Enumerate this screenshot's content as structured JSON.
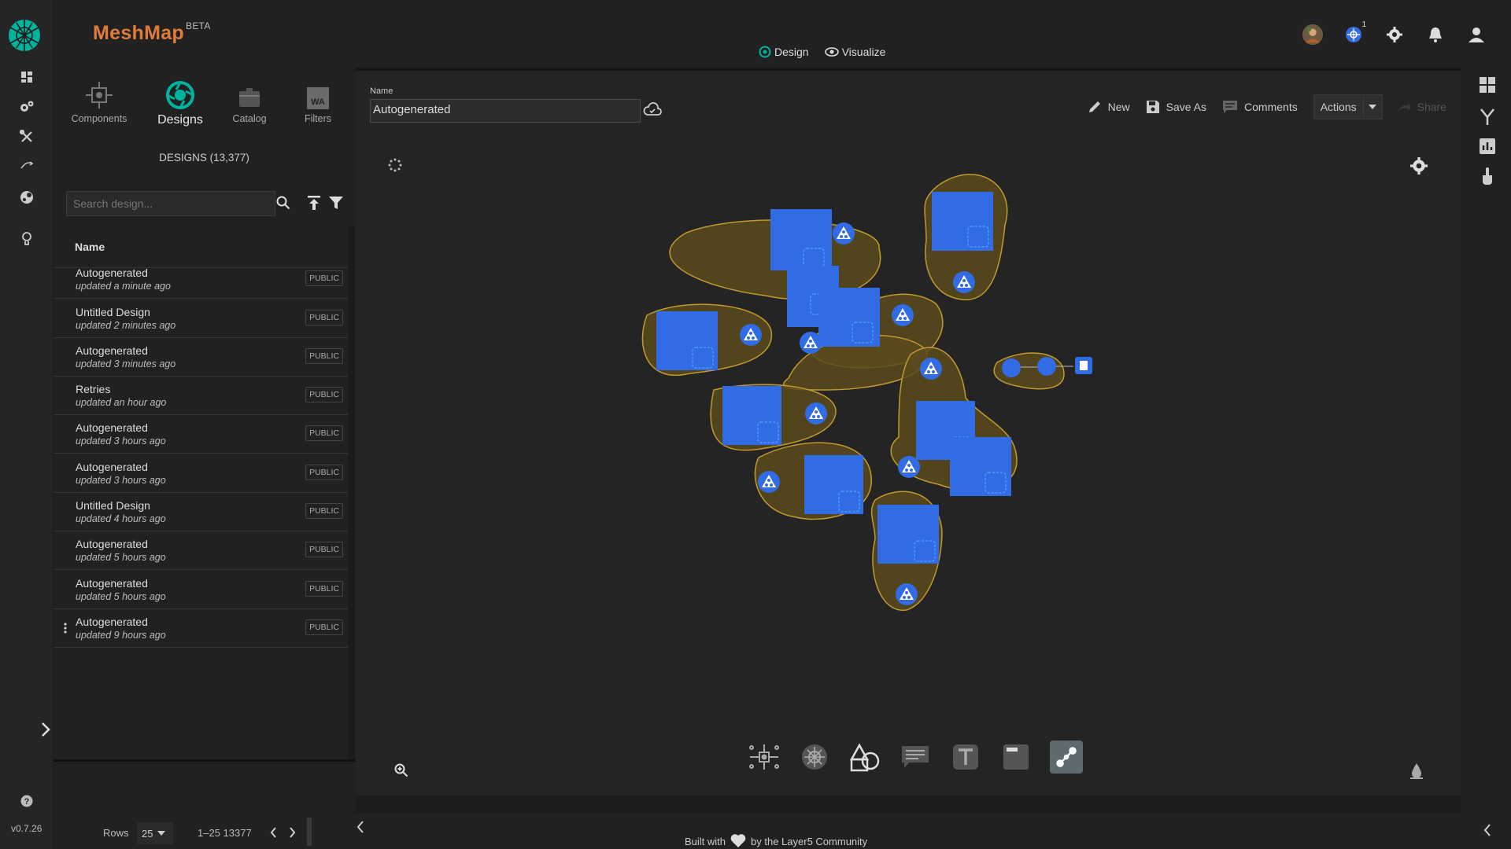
{
  "app": {
    "brand": "MeshMap",
    "brand_sup": "BETA",
    "version": "v0.7.26"
  },
  "header": {
    "modes": [
      {
        "label": "Design"
      },
      {
        "label": "Visualize"
      }
    ],
    "notification_count": "1"
  },
  "side_panel": {
    "tabs": [
      {
        "label": "Components"
      },
      {
        "label": "Designs"
      },
      {
        "label": "Catalog"
      },
      {
        "label": "Filters"
      }
    ],
    "filters_icon_text": "WA",
    "designs_count": "DESIGNS (13,377)",
    "search_placeholder": "Search design...",
    "column_header": "Name",
    "rows": [
      {
        "name": "Autogenerated",
        "updated": "updated a minute ago",
        "badge": "PUBLIC"
      },
      {
        "name": "Untitled Design",
        "updated": "updated 2 minutes ago",
        "badge": "PUBLIC"
      },
      {
        "name": "Autogenerated",
        "updated": "updated 3 minutes ago",
        "badge": "PUBLIC"
      },
      {
        "name": "Retries",
        "updated": "updated an hour ago",
        "badge": "PUBLIC"
      },
      {
        "name": "Autogenerated",
        "updated": "updated 3 hours ago",
        "badge": "PUBLIC"
      },
      {
        "name": "Autogenerated",
        "updated": "updated 3 hours ago",
        "badge": "PUBLIC"
      },
      {
        "name": "Untitled Design",
        "updated": "updated 4 hours ago",
        "badge": "PUBLIC"
      },
      {
        "name": "Autogenerated",
        "updated": "updated 5 hours ago",
        "badge": "PUBLIC"
      },
      {
        "name": "Autogenerated",
        "updated": "updated 5 hours ago",
        "badge": "PUBLIC"
      },
      {
        "name": "Autogenerated",
        "updated": "updated 9 hours ago",
        "badge": "PUBLIC"
      }
    ],
    "pager": {
      "rows_label": "Rows",
      "rows_value": "25",
      "range": "1–25 13377"
    }
  },
  "canvas": {
    "name_label": "Name",
    "name_value": "Autogenerated",
    "toolbar": {
      "new": "New",
      "save_as": "Save As",
      "comments": "Comments",
      "actions": "Actions",
      "share": "Share"
    }
  },
  "footer": {
    "prefix": "Built with",
    "suffix": "by the Layer5 Community"
  },
  "colors": {
    "brand": "#e07b39",
    "accent": "#00b39f",
    "node": "#326ce5",
    "group": "#8a6d1f"
  }
}
